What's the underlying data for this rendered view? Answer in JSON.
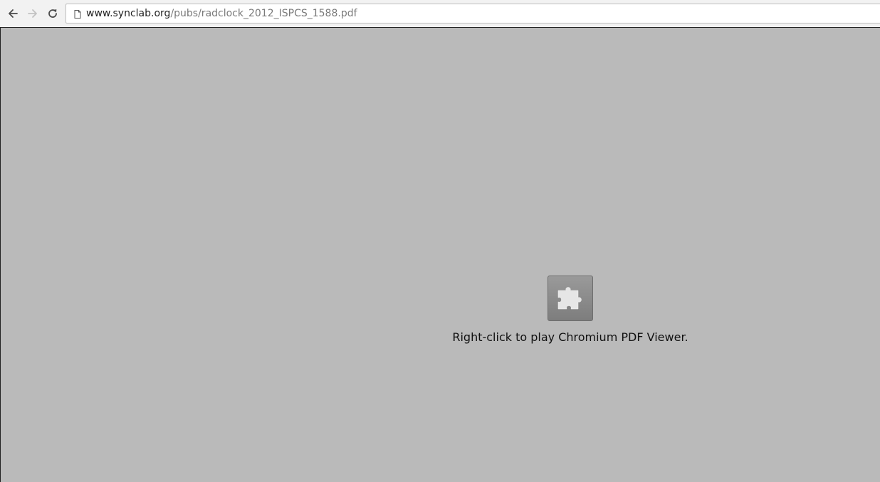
{
  "toolbar": {
    "back_icon": "arrow-left-icon",
    "forward_icon": "arrow-right-icon",
    "reload_icon": "reload-icon",
    "address": {
      "page_icon": "document-icon",
      "host": "www.synclab.org",
      "path": "/pubs/radclock_2012_ISPCS_1588.pdf"
    }
  },
  "content": {
    "plugin_icon": "puzzle-piece-icon",
    "message": "Right-click to play Chromium PDF Viewer."
  },
  "colors": {
    "toolbar_bg": "#f2f2f2",
    "content_bg": "#bababa",
    "puzzle_box": "#8a8a8a"
  }
}
